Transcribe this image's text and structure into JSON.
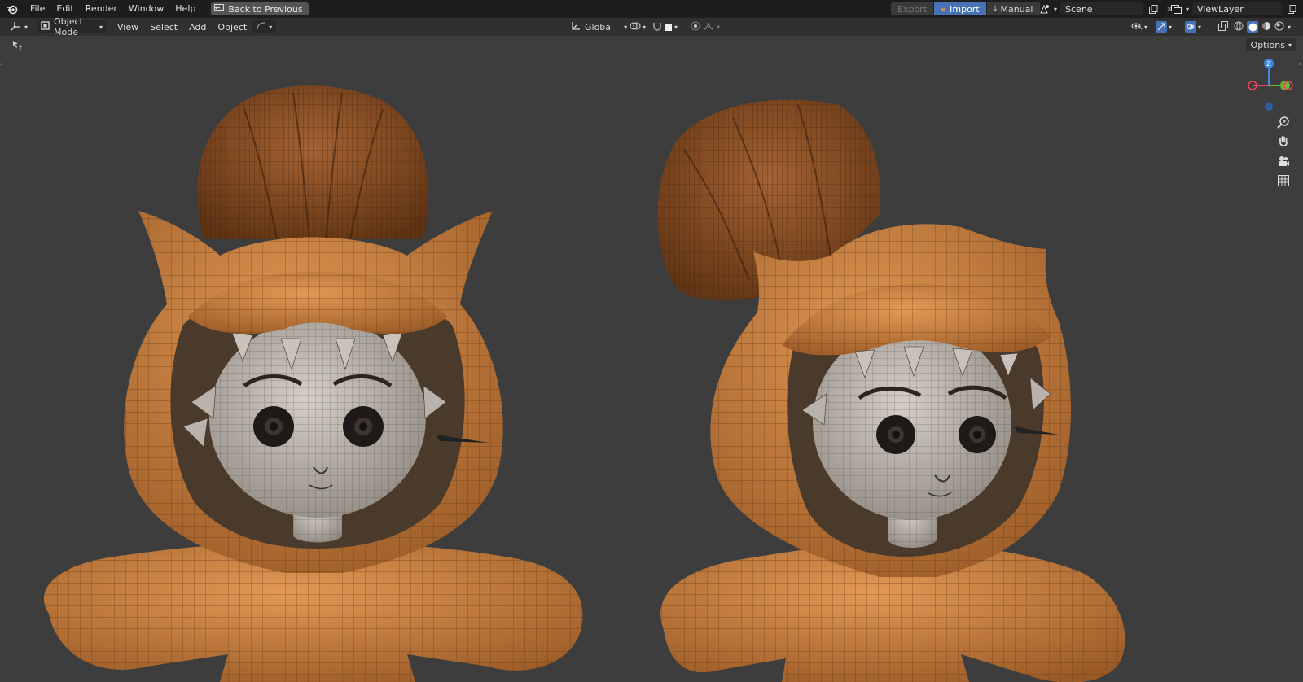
{
  "topbar": {
    "menus": [
      "File",
      "Edit",
      "Render",
      "Window",
      "Help"
    ],
    "back_label": "Back to Previous",
    "export_label": "Export",
    "import_label": "Import",
    "manual_label": "Manual",
    "scene_name": "Scene",
    "view_layer": "ViewLayer"
  },
  "header": {
    "mode": "Object Mode",
    "menus": [
      "View",
      "Select",
      "Add",
      "Object"
    ],
    "orientation": "Global"
  },
  "viewport": {
    "options_label": "Options",
    "gizmo": {
      "z_label": "Z",
      "x_color": "#e8475f",
      "y_color": "#6cb62d",
      "z_color": "#3e88e0"
    }
  },
  "colors": {
    "accent": "#4772b3",
    "mesh_orange": "#c7803f",
    "skin": "#bdb6ad",
    "background": "#3d3d3d"
  }
}
